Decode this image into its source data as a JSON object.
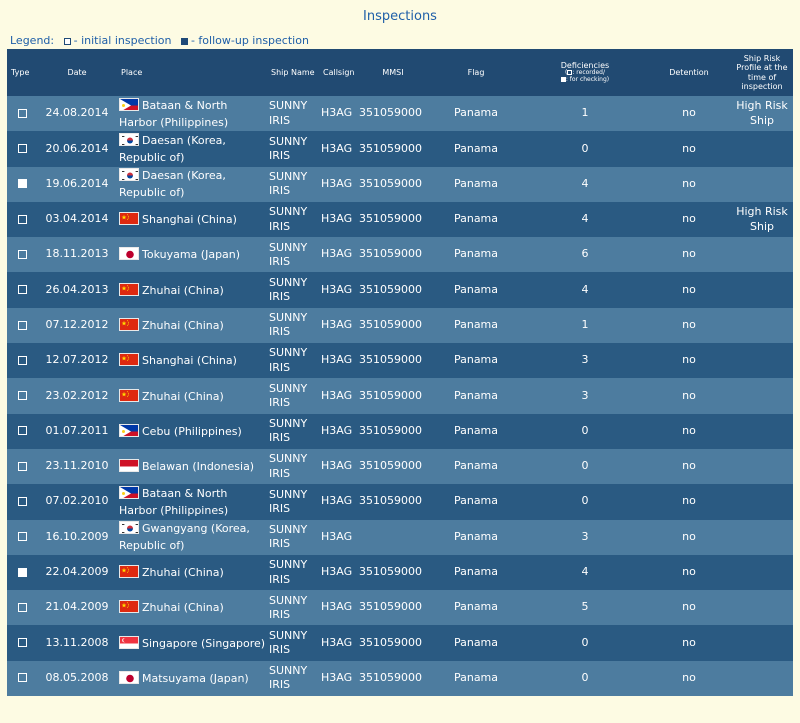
{
  "title": "Inspections",
  "legend": {
    "label": "Legend:",
    "initial": "- initial inspection",
    "followup": "- follow-up inspection"
  },
  "headers": {
    "type": "Type",
    "date": "Date",
    "place": "Place",
    "ship_name": "Ship Name",
    "callsign": "Callsign",
    "mmsi": "MMSI",
    "flag": "Flag",
    "deficiencies": "Deficiencies",
    "deficiencies_sub1": ": recorded/",
    "deficiencies_sub2": ": for checking)",
    "detention": "Detention",
    "risk": "Ship Risk Profile at the time of inspection"
  },
  "rows": [
    {
      "type": "initial",
      "date": "24.08.2014",
      "flag_icon": "philippines-flag-icon",
      "place": "Bataan & North Harbor (Philippines)",
      "ship": "SUNNY IRIS",
      "callsign": "H3AG",
      "mmsi": "351059000",
      "flag": "Panama",
      "deficiencies": "1",
      "detention": "no",
      "risk": "High Risk Ship"
    },
    {
      "type": "initial",
      "date": "20.06.2014",
      "flag_icon": "korea-flag-icon",
      "place": "Daesan (Korea, Republic of)",
      "ship": "SUNNY IRIS",
      "callsign": "H3AG",
      "mmsi": "351059000",
      "flag": "Panama",
      "deficiencies": "0",
      "detention": "no",
      "risk": ""
    },
    {
      "type": "followup",
      "date": "19.06.2014",
      "flag_icon": "korea-flag-icon",
      "place": "Daesan (Korea, Republic of)",
      "ship": "SUNNY IRIS",
      "callsign": "H3AG",
      "mmsi": "351059000",
      "flag": "Panama",
      "deficiencies": "4",
      "detention": "no",
      "risk": ""
    },
    {
      "type": "initial",
      "date": "03.04.2014",
      "flag_icon": "china-flag-icon",
      "place": "Shanghai (China)",
      "ship": "SUNNY IRIS",
      "callsign": "H3AG",
      "mmsi": "351059000",
      "flag": "Panama",
      "deficiencies": "4",
      "detention": "no",
      "risk": "High Risk Ship"
    },
    {
      "type": "initial",
      "date": "18.11.2013",
      "flag_icon": "japan-flag-icon",
      "place": "Tokuyama (Japan)",
      "ship": "SUNNY IRIS",
      "callsign": "H3AG",
      "mmsi": "351059000",
      "flag": "Panama",
      "deficiencies": "6",
      "detention": "no",
      "risk": ""
    },
    {
      "type": "initial",
      "date": "26.04.2013",
      "flag_icon": "china-flag-icon",
      "place": "Zhuhai (China)",
      "ship": "SUNNY IRIS",
      "callsign": "H3AG",
      "mmsi": "351059000",
      "flag": "Panama",
      "deficiencies": "4",
      "detention": "no",
      "risk": ""
    },
    {
      "type": "initial",
      "date": "07.12.2012",
      "flag_icon": "china-flag-icon",
      "place": "Zhuhai (China)",
      "ship": "SUNNY IRIS",
      "callsign": "H3AG",
      "mmsi": "351059000",
      "flag": "Panama",
      "deficiencies": "1",
      "detention": "no",
      "risk": ""
    },
    {
      "type": "initial",
      "date": "12.07.2012",
      "flag_icon": "china-flag-icon",
      "place": "Shanghai (China)",
      "ship": "SUNNY IRIS",
      "callsign": "H3AG",
      "mmsi": "351059000",
      "flag": "Panama",
      "deficiencies": "3",
      "detention": "no",
      "risk": ""
    },
    {
      "type": "initial",
      "date": "23.02.2012",
      "flag_icon": "china-flag-icon",
      "place": "Zhuhai (China)",
      "ship": "SUNNY IRIS",
      "callsign": "H3AG",
      "mmsi": "351059000",
      "flag": "Panama",
      "deficiencies": "3",
      "detention": "no",
      "risk": ""
    },
    {
      "type": "initial",
      "date": "01.07.2011",
      "flag_icon": "philippines-flag-icon",
      "place": "Cebu (Philippines)",
      "ship": "SUNNY IRIS",
      "callsign": "H3AG",
      "mmsi": "351059000",
      "flag": "Panama",
      "deficiencies": "0",
      "detention": "no",
      "risk": ""
    },
    {
      "type": "initial",
      "date": "23.11.2010",
      "flag_icon": "indonesia-flag-icon",
      "place": "Belawan (Indonesia)",
      "ship": "SUNNY IRIS",
      "callsign": "H3AG",
      "mmsi": "351059000",
      "flag": "Panama",
      "deficiencies": "0",
      "detention": "no",
      "risk": ""
    },
    {
      "type": "initial",
      "date": "07.02.2010",
      "flag_icon": "philippines-flag-icon",
      "place": "Bataan & North Harbor (Philippines)",
      "ship": "SUNNY IRIS",
      "callsign": "H3AG",
      "mmsi": "351059000",
      "flag": "Panama",
      "deficiencies": "0",
      "detention": "no",
      "risk": ""
    },
    {
      "type": "initial",
      "date": "16.10.2009",
      "flag_icon": "korea-flag-icon",
      "place": "Gwangyang (Korea, Republic of)",
      "ship": "SUNNY IRIS",
      "callsign": "H3AG",
      "mmsi": "",
      "flag": "Panama",
      "deficiencies": "3",
      "detention": "no",
      "risk": ""
    },
    {
      "type": "followup",
      "date": "22.04.2009",
      "flag_icon": "china-flag-icon",
      "place": "Zhuhai (China)",
      "ship": "SUNNY IRIS",
      "callsign": "H3AG",
      "mmsi": "351059000",
      "flag": "Panama",
      "deficiencies": "4",
      "detention": "no",
      "risk": ""
    },
    {
      "type": "initial",
      "date": "21.04.2009",
      "flag_icon": "china-flag-icon",
      "place": "Zhuhai (China)",
      "ship": "SUNNY IRIS",
      "callsign": "H3AG",
      "mmsi": "351059000",
      "flag": "Panama",
      "deficiencies": "5",
      "detention": "no",
      "risk": ""
    },
    {
      "type": "initial",
      "date": "13.11.2008",
      "flag_icon": "singapore-flag-icon",
      "place": "Singapore (Singapore)",
      "ship": "SUNNY IRIS",
      "callsign": "H3AG",
      "mmsi": "351059000",
      "flag": "Panama",
      "deficiencies": "0",
      "detention": "no",
      "risk": ""
    },
    {
      "type": "initial",
      "date": "08.05.2008",
      "flag_icon": "japan-flag-icon",
      "place": "Matsuyama (Japan)",
      "ship": "SUNNY IRIS",
      "callsign": "H3AG",
      "mmsi": "351059000",
      "flag": "Panama",
      "deficiencies": "0",
      "detention": "no",
      "risk": ""
    }
  ]
}
